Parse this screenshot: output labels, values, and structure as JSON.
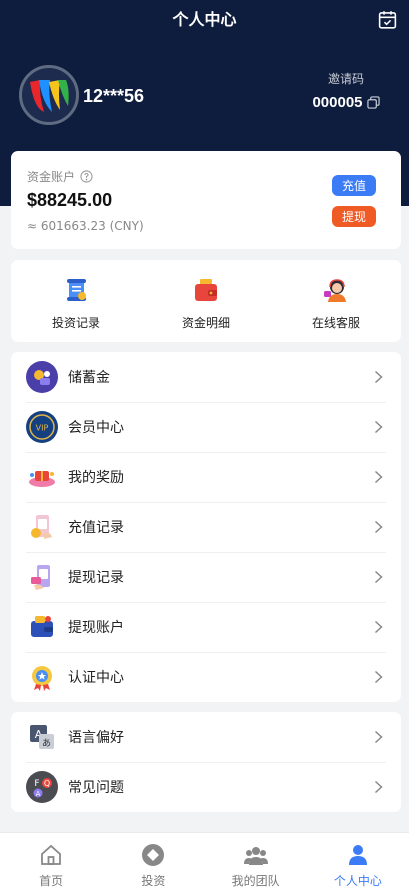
{
  "header": {
    "title": "个人中心",
    "calendar_icon": "calendar-check-icon"
  },
  "profile": {
    "username": "12***56",
    "invite_label": "邀请码",
    "invite_code": "000005"
  },
  "funds": {
    "label": "资金账户",
    "balance": "$88245.00",
    "cny": "≈ 601663.23 (CNY)",
    "recharge_label": "充值",
    "withdraw_label": "提现"
  },
  "quick": [
    {
      "label": "投资记录",
      "icon": "scroll-icon"
    },
    {
      "label": "资金明细",
      "icon": "wallet-icon"
    },
    {
      "label": "在线客服",
      "icon": "support-agent-icon"
    }
  ],
  "menu1": [
    {
      "label": "储蓄金",
      "icon": "savings-icon"
    },
    {
      "label": "会员中心",
      "icon": "vip-badge-icon"
    },
    {
      "label": "我的奖励",
      "icon": "rewards-icon"
    },
    {
      "label": "充值记录",
      "icon": "recharge-record-icon"
    },
    {
      "label": "提现记录",
      "icon": "withdraw-record-icon"
    },
    {
      "label": "提现账户",
      "icon": "withdraw-account-icon"
    },
    {
      "label": "认证中心",
      "icon": "certification-medal-icon"
    }
  ],
  "menu2": [
    {
      "label": "语言偏好",
      "icon": "language-icon"
    },
    {
      "label": "常见问题",
      "icon": "faq-icon"
    }
  ],
  "tabs": [
    {
      "label": "首页",
      "icon": "home-icon",
      "active": false
    },
    {
      "label": "投资",
      "icon": "invest-icon",
      "active": false
    },
    {
      "label": "我的团队",
      "icon": "team-icon",
      "active": false
    },
    {
      "label": "个人中心",
      "icon": "user-icon",
      "active": true
    }
  ],
  "colors": {
    "header_bg": "#0e1d3d",
    "accent": "#3b7cf6",
    "withdraw": "#f05a24"
  }
}
